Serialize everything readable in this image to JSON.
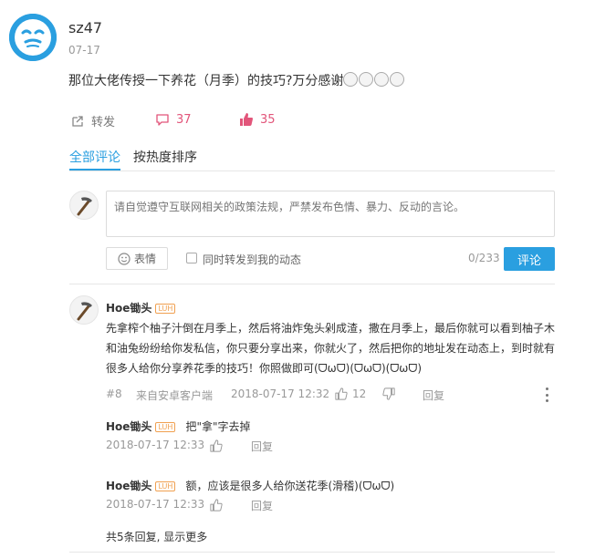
{
  "post": {
    "username": "sz47",
    "date": "07-17",
    "text": "那位大佬传授一下养花（月季）的技巧?万分感谢",
    "emoji_count": 4
  },
  "actions": {
    "repost_label": "转发",
    "comment_count": "37",
    "like_count": "35"
  },
  "tabs": [
    {
      "label": "全部评论",
      "active": true
    },
    {
      "label": "按热度排序",
      "active": false
    }
  ],
  "composer": {
    "placeholder": "请自觉遵守互联网相关的政策法规，严禁发布色情、暴力、反动的言论。",
    "emoji_label": "表情",
    "sync_label": "同时转发到我的动态",
    "count": "0/233",
    "submit_label": "评论"
  },
  "comment": {
    "author": "Hoe锄头",
    "badge": "LUH",
    "body": "先拿榨个柚子汁倒在月季上，然后将油炸兔头剁成渣，撒在月季上，最后你就可以看到柚子木和油兔纷纷给你发私信，你只要分享出来，你就火了，然后把你的地址发在动态上，到时就有很多人给你分享养花季的技巧！你照做即可(ᗜωᗜ)(ᗜωᗜ)(ᗜωᗜ)",
    "floor": "#8",
    "source": "来自安卓客户端",
    "time": "2018-07-17 12:32",
    "likes": "12",
    "reply_label": "回复"
  },
  "replies": [
    {
      "author": "Hoe锄头",
      "badge": "LUH",
      "text": "把\"拿\"字去掉",
      "time": "2018-07-17 12:33",
      "reply_label": "回复"
    },
    {
      "author": "Hoe锄头",
      "badge": "LUH",
      "text": "额，应该是很多人给你送花季(滑稽)(ᗜωᗜ)",
      "time": "2018-07-17 12:33",
      "reply_label": "回复"
    }
  ],
  "show_more": "共5条回复, 显示更多",
  "colors": {
    "accent": "#2a9fe0",
    "like": "#e2557a"
  }
}
